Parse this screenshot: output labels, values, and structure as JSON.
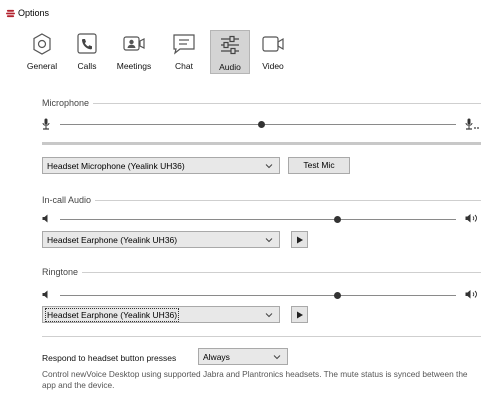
{
  "window": {
    "title": "Options"
  },
  "toolbar": {
    "items": [
      {
        "label": "General",
        "icon": "gear-icon"
      },
      {
        "label": "Calls",
        "icon": "phone-icon"
      },
      {
        "label": "Meetings",
        "icon": "meeting-camera-icon"
      },
      {
        "label": "Chat",
        "icon": "chat-bubble-icon"
      },
      {
        "label": "Audio",
        "icon": "sliders-icon",
        "active": true
      },
      {
        "label": "Video",
        "icon": "video-camera-icon"
      }
    ]
  },
  "audio": {
    "microphone": {
      "label": "Microphone",
      "level": 0.51,
      "device": "Headset Microphone (Yealink UH36)",
      "test_label": "Test Mic"
    },
    "incall": {
      "label": "In-call Audio",
      "level": 0.7,
      "device": "Headset Earphone (Yealink UH36)"
    },
    "ringtone": {
      "label": "Ringtone",
      "level": 0.7,
      "device": "Headset Earphone (Yealink UH36)"
    },
    "headset_buttons": {
      "label": "Respond to headset button presses",
      "value": "Always",
      "description": "Control newVoice Desktop using supported Jabra and Plantronics headsets. The mute status is synced between the app and the device."
    }
  },
  "colors": {
    "active_tab_bg": "#d4d4d4",
    "app_icon": "#b3232f",
    "slider_thumb": "#333333"
  }
}
